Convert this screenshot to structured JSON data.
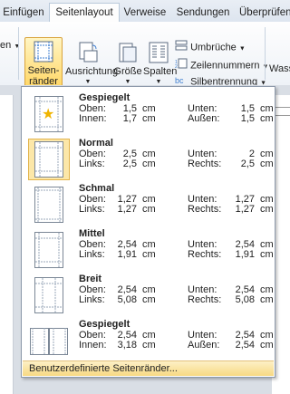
{
  "tabs": [
    "Einfügen",
    "Seitenlayout",
    "Verweise",
    "Sendungen",
    "Überprüfen"
  ],
  "ribbon": {
    "seitenraender_line1": "Seiten-",
    "seitenraender_line2": "ränder",
    "ausrichtung": "Ausrichtung",
    "groesse": "Größe",
    "spalten": "Spalten",
    "umbrueche": "Umbrüche",
    "zeilennummern": "Zeilennummern",
    "silbentrennung": "Silbentrennung",
    "left_partial": "en",
    "right_partial": "Wasse"
  },
  "menu": {
    "items": [
      {
        "title": "Gespiegelt",
        "l1": "Oben:",
        "v1": "1,5",
        "u1": "cm",
        "l2": "Unten:",
        "v2": "1,5",
        "u2": "cm",
        "l3": "Innen:",
        "v3": "1,7",
        "u3": "cm",
        "l4": "Außen:",
        "v4": "1,5",
        "u4": "cm",
        "icon": "mirrored-star"
      },
      {
        "title": "Normal",
        "l1": "Oben:",
        "v1": "2,5",
        "u1": "cm",
        "l2": "Unten:",
        "v2": "2",
        "u2": "cm",
        "l3": "Links:",
        "v3": "2,5",
        "u3": "cm",
        "l4": "Rechts:",
        "v4": "2,5",
        "u4": "cm",
        "icon": "normal"
      },
      {
        "title": "Schmal",
        "l1": "Oben:",
        "v1": "1,27",
        "u1": "cm",
        "l2": "Unten:",
        "v2": "1,27",
        "u2": "cm",
        "l3": "Links:",
        "v3": "1,27",
        "u3": "cm",
        "l4": "Rechts:",
        "v4": "1,27",
        "u4": "cm",
        "icon": "narrow"
      },
      {
        "title": "Mittel",
        "l1": "Oben:",
        "v1": "2,54",
        "u1": "cm",
        "l2": "Unten:",
        "v2": "2,54",
        "u2": "cm",
        "l3": "Links:",
        "v3": "1,91",
        "u3": "cm",
        "l4": "Rechts:",
        "v4": "1,91",
        "u4": "cm",
        "icon": "moderate"
      },
      {
        "title": "Breit",
        "l1": "Oben:",
        "v1": "2,54",
        "u1": "cm",
        "l2": "Unten:",
        "v2": "2,54",
        "u2": "cm",
        "l3": "Links:",
        "v3": "5,08",
        "u3": "cm",
        "l4": "Rechts:",
        "v4": "5,08",
        "u4": "cm",
        "icon": "wide"
      },
      {
        "title": "Gespiegelt",
        "l1": "Oben:",
        "v1": "2,54",
        "u1": "cm",
        "l2": "Unten:",
        "v2": "2,54",
        "u2": "cm",
        "l3": "Innen:",
        "v3": "3,18",
        "u3": "cm",
        "l4": "Außen:",
        "v4": "2,54",
        "u4": "cm",
        "icon": "mirrored-book"
      }
    ],
    "footer": "Benutzerdefinierte Seitenränder..."
  },
  "colors": {
    "accent": "#ffd766",
    "highlight": "#fce7a8"
  }
}
